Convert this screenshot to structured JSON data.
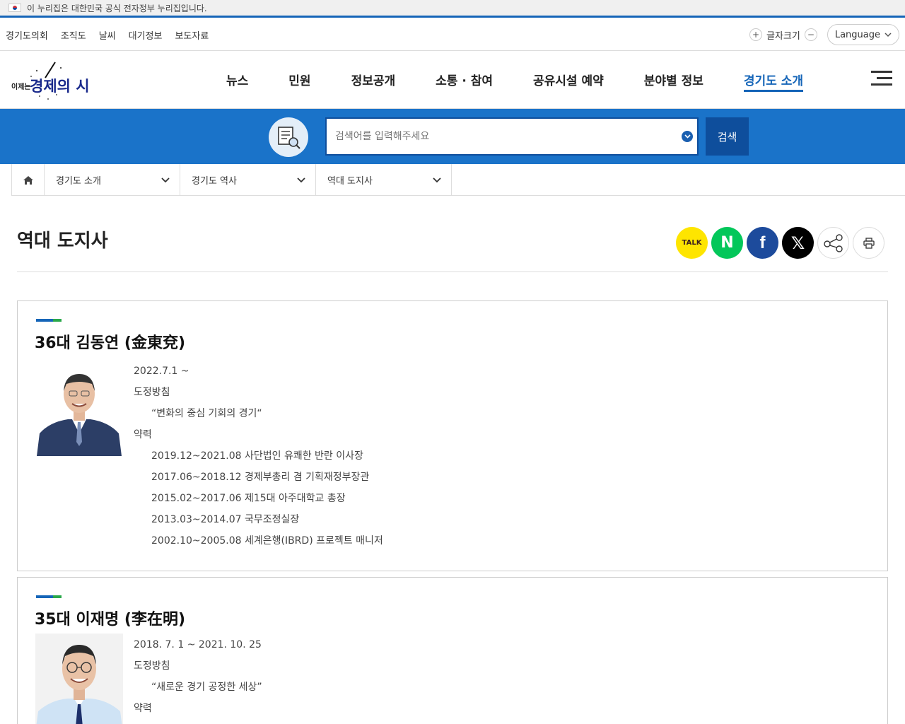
{
  "gov_banner": {
    "text": "이 누리집은 대한민국 공식 전자정부 누리집입니다."
  },
  "utility": {
    "links": [
      "경기도의회",
      "조직도",
      "날씨",
      "대기정보",
      "보도자료"
    ],
    "fontsize_label": "글자크기",
    "language_label": "Language"
  },
  "header": {
    "logo_text_small": "이제는",
    "logo_text_big": "경제의 시간",
    "nav": [
      "뉴스",
      "민원",
      "정보공개",
      "소통 · 참여",
      "공유시설 예약",
      "분야별 정보",
      "경기도 소개"
    ],
    "active_nav": "경기도 소개"
  },
  "search": {
    "placeholder": "검색어를 입력해주세요",
    "button_label": "검색"
  },
  "breadcrumb": [
    "경기도 소개",
    "경기도 역사",
    "역대 도지사"
  ],
  "page": {
    "title": "역대 도지사",
    "share": {
      "kakao_label": "TALK",
      "naver_label": "N",
      "facebook_label": "f",
      "x_label": "𝕏"
    }
  },
  "governors": [
    {
      "name": "36대 김동연 (金東兗)",
      "term": "2022.7.1 ~",
      "policy_label": "도정방침",
      "policy": "“변화의 중심 기회의 경기“",
      "career_label": "약력",
      "career": [
        "2019.12~2021.08 사단법인 유쾌한 반란 이사장",
        "2017.06~2018.12 경제부총리 겸 기획재정부장관",
        "2015.02~2017.06 제15대 아주대학교 총장",
        "2013.03~2014.07 국무조정실장",
        "2002.10~2005.08 세계은행(IBRD) 프로젝트 매니저"
      ]
    },
    {
      "name": "35대 이재명 (李在明)",
      "term": "2018. 7. 1 ~ 2021. 10. 25",
      "policy_label": "도정방침",
      "policy": "“새로운 경기 공정한 세상”",
      "career_label": "약력",
      "career": []
    }
  ]
}
